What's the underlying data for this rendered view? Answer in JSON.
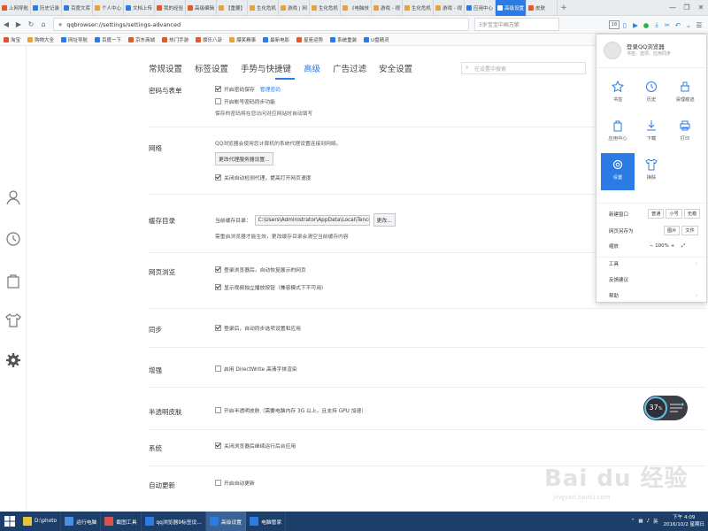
{
  "tabs": [
    {
      "label": "上网导航",
      "color": "#e05a2b"
    },
    {
      "label": "历史记录",
      "color": "#2b7be4"
    },
    {
      "label": "百度文库",
      "color": "#2b7be4"
    },
    {
      "label": "个人中心",
      "color": "#e8a23b"
    },
    {
      "label": "文档上传",
      "color": "#2b7be4"
    },
    {
      "label": "我的经验",
      "color": "#e05a2b"
    },
    {
      "label": "高级编辑",
      "color": "#e05a2b"
    },
    {
      "label": "【重要】",
      "color": "#e8a23b"
    },
    {
      "label": "生化危机",
      "color": "#e8a23b"
    },
    {
      "label": "游戏 | 网",
      "color": "#e8a23b"
    },
    {
      "label": "生化危机",
      "color": "#e8a23b"
    },
    {
      "label": "《电脑技",
      "color": "#e8a23b"
    },
    {
      "label": "游戏 - 视",
      "color": "#e8a23b"
    },
    {
      "label": "生化危机",
      "color": "#e8a23b"
    },
    {
      "label": "游戏 - 视",
      "color": "#e8a23b"
    },
    {
      "label": "应用中心",
      "color": "#2b7be4"
    },
    {
      "label": "高级设置",
      "color": "#ffffff",
      "active": true
    },
    {
      "label": "皮肤",
      "color": "#e05a2b"
    }
  ],
  "window": {
    "minimize": "—",
    "restore": "❐",
    "close": "✕"
  },
  "address": {
    "url": "qqbrowser://settings/settings-advanced",
    "search_placeholder": "3岁宝宝中画万紫",
    "counter": "18"
  },
  "bookmarks": [
    {
      "label": "淘宝",
      "color": "#e8502b"
    },
    {
      "label": "购物大全",
      "color": "#e8a23b"
    },
    {
      "label": "网址导航",
      "color": "#2b7be4"
    },
    {
      "label": "百度一下",
      "color": "#2b7be4"
    },
    {
      "label": "京东商城",
      "color": "#e05a2b"
    },
    {
      "label": "热门手游",
      "color": "#e05a2b"
    },
    {
      "label": "娱乐八卦",
      "color": "#e05a2b"
    },
    {
      "label": "爆笑糗事",
      "color": "#e8a23b"
    },
    {
      "label": "最新电影",
      "color": "#2b7be4"
    },
    {
      "label": "星座运势",
      "color": "#e05a2b"
    },
    {
      "label": "系统重装",
      "color": "#2b7be4"
    },
    {
      "label": "U盘精灵",
      "color": "#2b7be4"
    }
  ],
  "settings_nav": {
    "items": [
      "常规设置",
      "标签设置",
      "手势与快捷键",
      "高级",
      "广告过滤",
      "安全设置"
    ],
    "search_placeholder": "在设置中搜索"
  },
  "sections": {
    "password": {
      "title": "密码与表单",
      "opt1": "开启密码保存",
      "manage": "管理密码",
      "opt2": "开启帐号密码同步功能",
      "note": "保存的密码将在您访问对应网站时自动填写"
    },
    "network": {
      "title": "网络",
      "desc": "QQ浏览器会使用您计算机的系统代理设置连接到网络。",
      "proxy_btn": "更改代理服务器设置...",
      "opt": "关闭自动检测代理，提高打开网页速度"
    },
    "cache": {
      "title": "缓存目录",
      "label": "当前缓存目录：",
      "path": "C:\\Users\\Administrator\\AppData\\Local\\Tencent\\QQ",
      "change": "更改...",
      "note": "需重启浏览器才能生效，更改缓存目录会清空当前缓存内容"
    },
    "browse": {
      "title": "网页浏览",
      "opt1": "登录浏览器后，自动恢复展示的网页",
      "opt2": "显示视频独立播放按钮（兼容模式下不可用）"
    },
    "sync": {
      "title": "同步",
      "opt": "登录后，自动同步选项设置和应用"
    },
    "enhance": {
      "title": "增强",
      "opt": "启用 DirectWrite 高清字体渲染"
    },
    "skin": {
      "title": "半透明皮肤",
      "opt": "开启半透明皮肤（需要电脑内存 3G 以上，且支持 GPU 加速）"
    },
    "system": {
      "title": "系统",
      "opt": "关闭浏览器后继续运行后台应用"
    },
    "update": {
      "title": "自动更新",
      "opt": "开启自动更新"
    }
  },
  "menu": {
    "login_title": "登录QQ浏览器",
    "login_sub": "书签、选项、应用同步",
    "grid": [
      "书签",
      "历史",
      "清理痕迹",
      "应用中心",
      "下载",
      "打印",
      "设置",
      "换肤"
    ],
    "new_window": "新建窗口",
    "nw_opts": [
      "普通",
      "小号",
      "无痕"
    ],
    "save_as": "网页另存为",
    "save_opts": [
      "图片",
      "文件"
    ],
    "zoom_label": "缩放",
    "zoom_minus": "−",
    "zoom_value": "100%",
    "zoom_plus": "+",
    "tools": "工具",
    "feedback": "反馈建议",
    "help": "帮助"
  },
  "speed_widget": {
    "value": "37",
    "unit": "%"
  },
  "watermark": {
    "text": "Bai du 经验",
    "sub": "jingyan.baidu.com"
  },
  "taskbar": {
    "items": [
      {
        "label": "D:\\photo",
        "color": "#e8c23b"
      },
      {
        "label": "运行电脑",
        "color": "#4a8ee0"
      },
      {
        "label": "截图工具",
        "color": "#d9534f"
      },
      {
        "label": "qq浏览器9标签设...",
        "color": "#2b7be4"
      },
      {
        "label": "高级设置",
        "color": "#2b7be4",
        "active": true
      },
      {
        "label": "电脑管家",
        "color": "#2b7be4"
      }
    ],
    "time": "下午 4:09",
    "date": "2016/10/2 星期日",
    "ime": "英"
  }
}
